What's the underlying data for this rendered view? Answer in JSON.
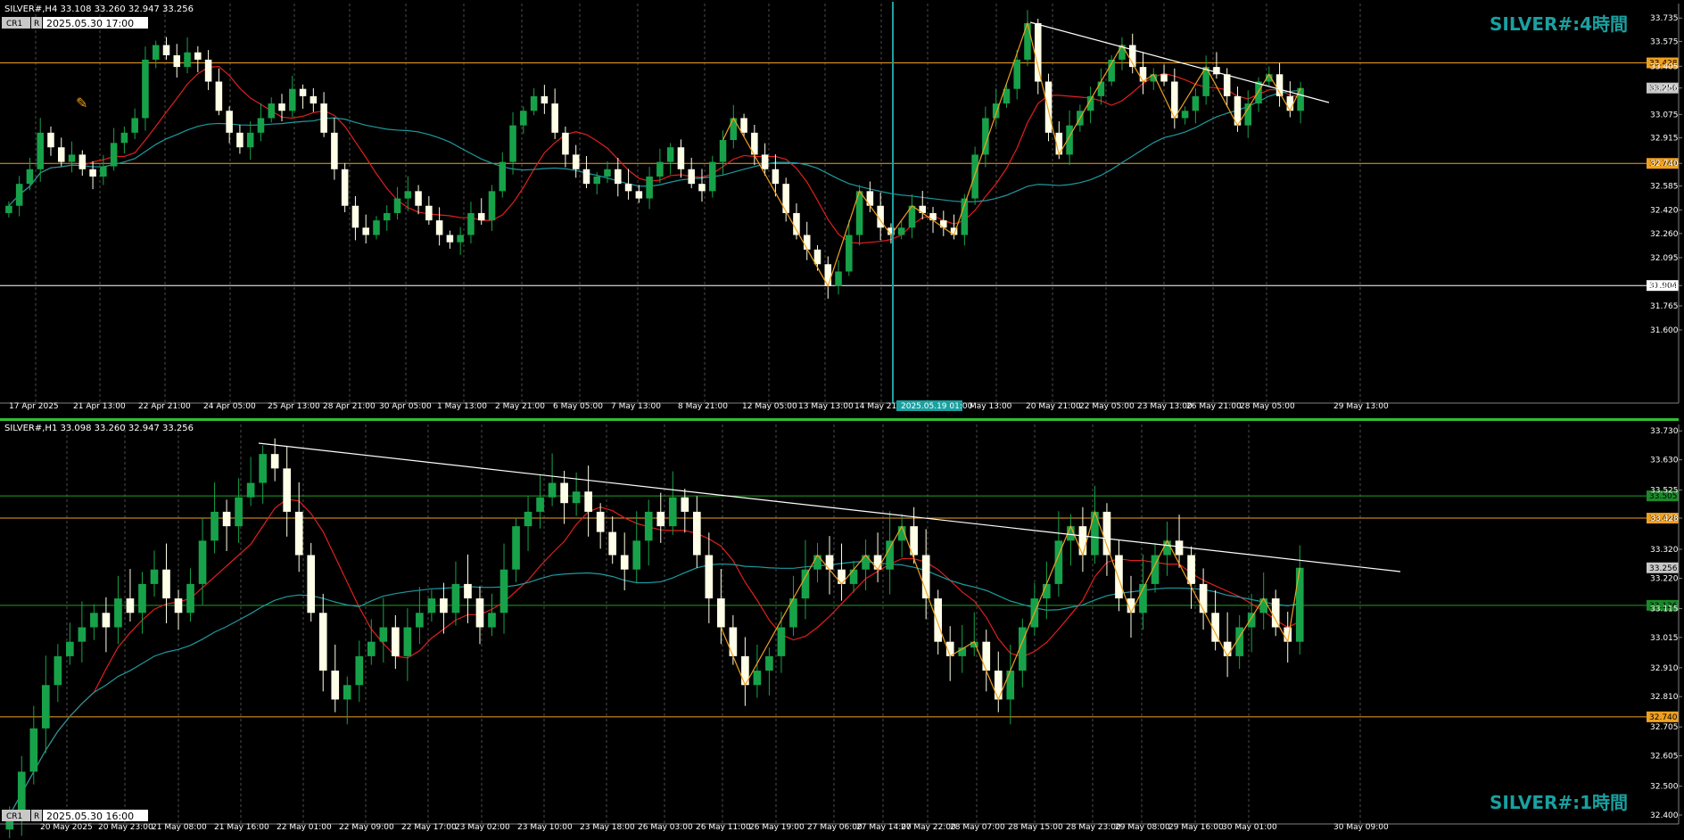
{
  "colors": {
    "background": "#000000",
    "grid": "#c8c8c8",
    "bull_candle": "#17a24a",
    "bear_candle": "#ffffe8",
    "ma_fast": "#e0201e",
    "ma_slow": "#1e9aa0",
    "zigzag": "#f0a020",
    "support": "#f0a020",
    "resistance": "#f0a020",
    "green_level": "#20a020",
    "white_level": "#ffffff",
    "trendline": "#ffffff",
    "title": "#1aa0a0",
    "cursor_line": "#20a0a0",
    "price_tag_bg": "#c8c8c8",
    "divider": "#30c030"
  },
  "top_panel": {
    "header": "SILVER#,H4  33.108 33.260 32.947 33.256",
    "cr_label": "CR1",
    "r_label": "R",
    "date_box": "2025.05.30 17:00",
    "title": "SILVER#:4時間",
    "current_price_tag": "33.256",
    "level_tags": [
      "33.428",
      "32.740",
      "31.904"
    ],
    "cursor_time_tag": "2025.05.19 01:00"
  },
  "bottom_panel": {
    "header": "SILVER#,H1  33.098 33.260 32.947 33.256",
    "cr_label": "CR1",
    "r_label": "R",
    "date_box": "2025.05.30 16:00",
    "title": "SILVER#:1時間",
    "current_price_tag": "33.256",
    "level_tags": [
      "33.505",
      "33.428",
      "33.126",
      "32.740"
    ]
  },
  "chart_data": [
    {
      "type": "candlestick",
      "title": "SILVER#:4時間",
      "symbol": "SILVER#",
      "timeframe": "H4",
      "ylim": [
        31.6,
        33.773
      ],
      "y_ticks": [
        "33.735",
        "33.575",
        "33.405",
        "33.256",
        "33.075",
        "32.915",
        "32.740",
        "32.585",
        "32.420",
        "32.260",
        "32.095",
        "31.904",
        "31.765",
        "31.600"
      ],
      "x_ticks": [
        "17 Apr 2025",
        "21 Apr 13:00",
        "22 Apr 21:00",
        "24 Apr 05:00",
        "25 Apr 13:00",
        "28 Apr 21:00",
        "30 Apr 05:00",
        "1 May 13:00",
        "2 May 21:00",
        "6 May 05:00",
        "7 May 13:00",
        "8 May 21:00",
        "12 May 05:00",
        "13 May 13:00",
        "14 May 21:00",
        "2025.05.19 01:00",
        "May 13:00",
        "20 May 21:00",
        "22 May 05:00",
        "23 May 13:00",
        "26 May 21:00",
        "28 May 05:00",
        "29 May 13:00"
      ],
      "horizontal_levels": [
        {
          "value": 33.428,
          "kind": "resistance"
        },
        {
          "value": 32.74,
          "kind": "support"
        },
        {
          "value": 31.904,
          "kind": "support"
        }
      ],
      "last_price": 33.256,
      "trendline": {
        "from": [
          0,
          33.7
        ],
        "to": [
          1,
          33.28
        ]
      },
      "close_series": [
        32.45,
        32.6,
        32.7,
        32.95,
        32.85,
        32.75,
        32.8,
        32.7,
        32.65,
        32.72,
        32.88,
        32.95,
        33.05,
        33.45,
        33.55,
        33.48,
        33.4,
        33.5,
        33.45,
        33.3,
        33.1,
        32.95,
        32.85,
        32.95,
        33.05,
        33.15,
        33.1,
        33.25,
        33.2,
        33.15,
        32.95,
        32.7,
        32.45,
        32.3,
        32.25,
        32.35,
        32.4,
        32.5,
        32.55,
        32.45,
        32.35,
        32.25,
        32.2,
        32.25,
        32.4,
        32.35,
        32.55,
        32.75,
        33.0,
        33.1,
        33.2,
        33.15,
        32.95,
        32.8,
        32.7,
        32.6,
        32.65,
        32.7,
        32.6,
        32.55,
        32.5,
        32.65,
        32.75,
        32.85,
        32.7,
        32.6,
        32.55,
        32.75,
        32.9,
        33.05,
        32.95,
        32.8,
        32.7,
        32.6,
        32.4,
        32.25,
        32.15,
        32.05,
        31.9,
        32.0,
        32.25,
        32.55,
        32.45,
        32.3,
        32.25,
        32.3,
        32.45,
        32.4,
        32.35,
        32.3,
        32.25,
        32.5,
        32.8,
        33.05,
        33.15,
        33.25,
        33.45,
        33.7,
        33.3,
        32.95,
        32.8,
        33.0,
        33.1,
        33.2,
        33.3,
        33.45,
        33.55,
        33.4,
        33.3,
        33.35,
        33.3,
        33.05,
        33.1,
        33.2,
        33.4,
        33.35,
        33.2,
        33.0,
        33.15,
        33.3,
        33.35,
        33.2,
        33.1,
        33.256
      ]
    },
    {
      "type": "candlestick",
      "title": "SILVER#:1時間",
      "symbol": "SILVER#",
      "timeframe": "H1",
      "ylim": [
        32.4,
        33.74
      ],
      "y_ticks": [
        "33.730",
        "33.630",
        "33.525",
        "33.428",
        "33.320",
        "33.220",
        "33.115",
        "33.015",
        "32.910",
        "32.810",
        "32.705",
        "32.605",
        "32.500",
        "32.400"
      ],
      "x_ticks": [
        "20 May 2025",
        "20 May 23:00",
        "21 May 08:00",
        "21 May 16:00",
        "22 May 01:00",
        "22 May 09:00",
        "22 May 17:00",
        "23 May 02:00",
        "23 May 10:00",
        "23 May 18:00",
        "26 May 03:00",
        "26 May 11:00",
        "26 May 19:00",
        "27 May 06:00",
        "27 May 14:00",
        "27 May 22:00",
        "28 May 07:00",
        "28 May 15:00",
        "28 May 23:00",
        "29 May 08:00",
        "29 May 16:00",
        "30 May 01:00",
        "30 May 09:00"
      ],
      "horizontal_levels": [
        {
          "value": 33.505,
          "kind": "green"
        },
        {
          "value": 33.428,
          "kind": "resistance"
        },
        {
          "value": 33.126,
          "kind": "green"
        },
        {
          "value": 32.74,
          "kind": "support"
        }
      ],
      "last_price": 33.256,
      "trendline": {
        "from": [
          0,
          33.7
        ],
        "to": [
          1,
          33.24
        ]
      },
      "close_series": [
        32.4,
        32.55,
        32.7,
        32.85,
        32.95,
        33.0,
        33.05,
        33.1,
        33.05,
        33.15,
        33.1,
        33.2,
        33.25,
        33.15,
        33.1,
        33.2,
        33.35,
        33.45,
        33.4,
        33.5,
        33.55,
        33.65,
        33.6,
        33.45,
        33.3,
        33.1,
        32.9,
        32.8,
        32.85,
        32.95,
        33.0,
        33.05,
        32.95,
        33.05,
        33.1,
        33.15,
        33.1,
        33.2,
        33.15,
        33.05,
        33.1,
        33.25,
        33.4,
        33.45,
        33.5,
        33.55,
        33.48,
        33.52,
        33.45,
        33.38,
        33.3,
        33.25,
        33.35,
        33.45,
        33.4,
        33.5,
        33.45,
        33.3,
        33.15,
        33.05,
        32.95,
        32.85,
        32.9,
        32.95,
        33.05,
        33.15,
        33.25,
        33.3,
        33.25,
        33.2,
        33.25,
        33.3,
        33.25,
        33.35,
        33.4,
        33.3,
        33.15,
        33.0,
        32.95,
        32.98,
        33.0,
        32.9,
        32.8,
        32.9,
        33.05,
        33.15,
        33.2,
        33.35,
        33.4,
        33.3,
        33.45,
        33.3,
        33.15,
        33.1,
        33.2,
        33.3,
        33.35,
        33.3,
        33.2,
        33.1,
        33.0,
        32.95,
        33.05,
        33.1,
        33.15,
        33.05,
        33.0,
        33.256
      ]
    }
  ]
}
